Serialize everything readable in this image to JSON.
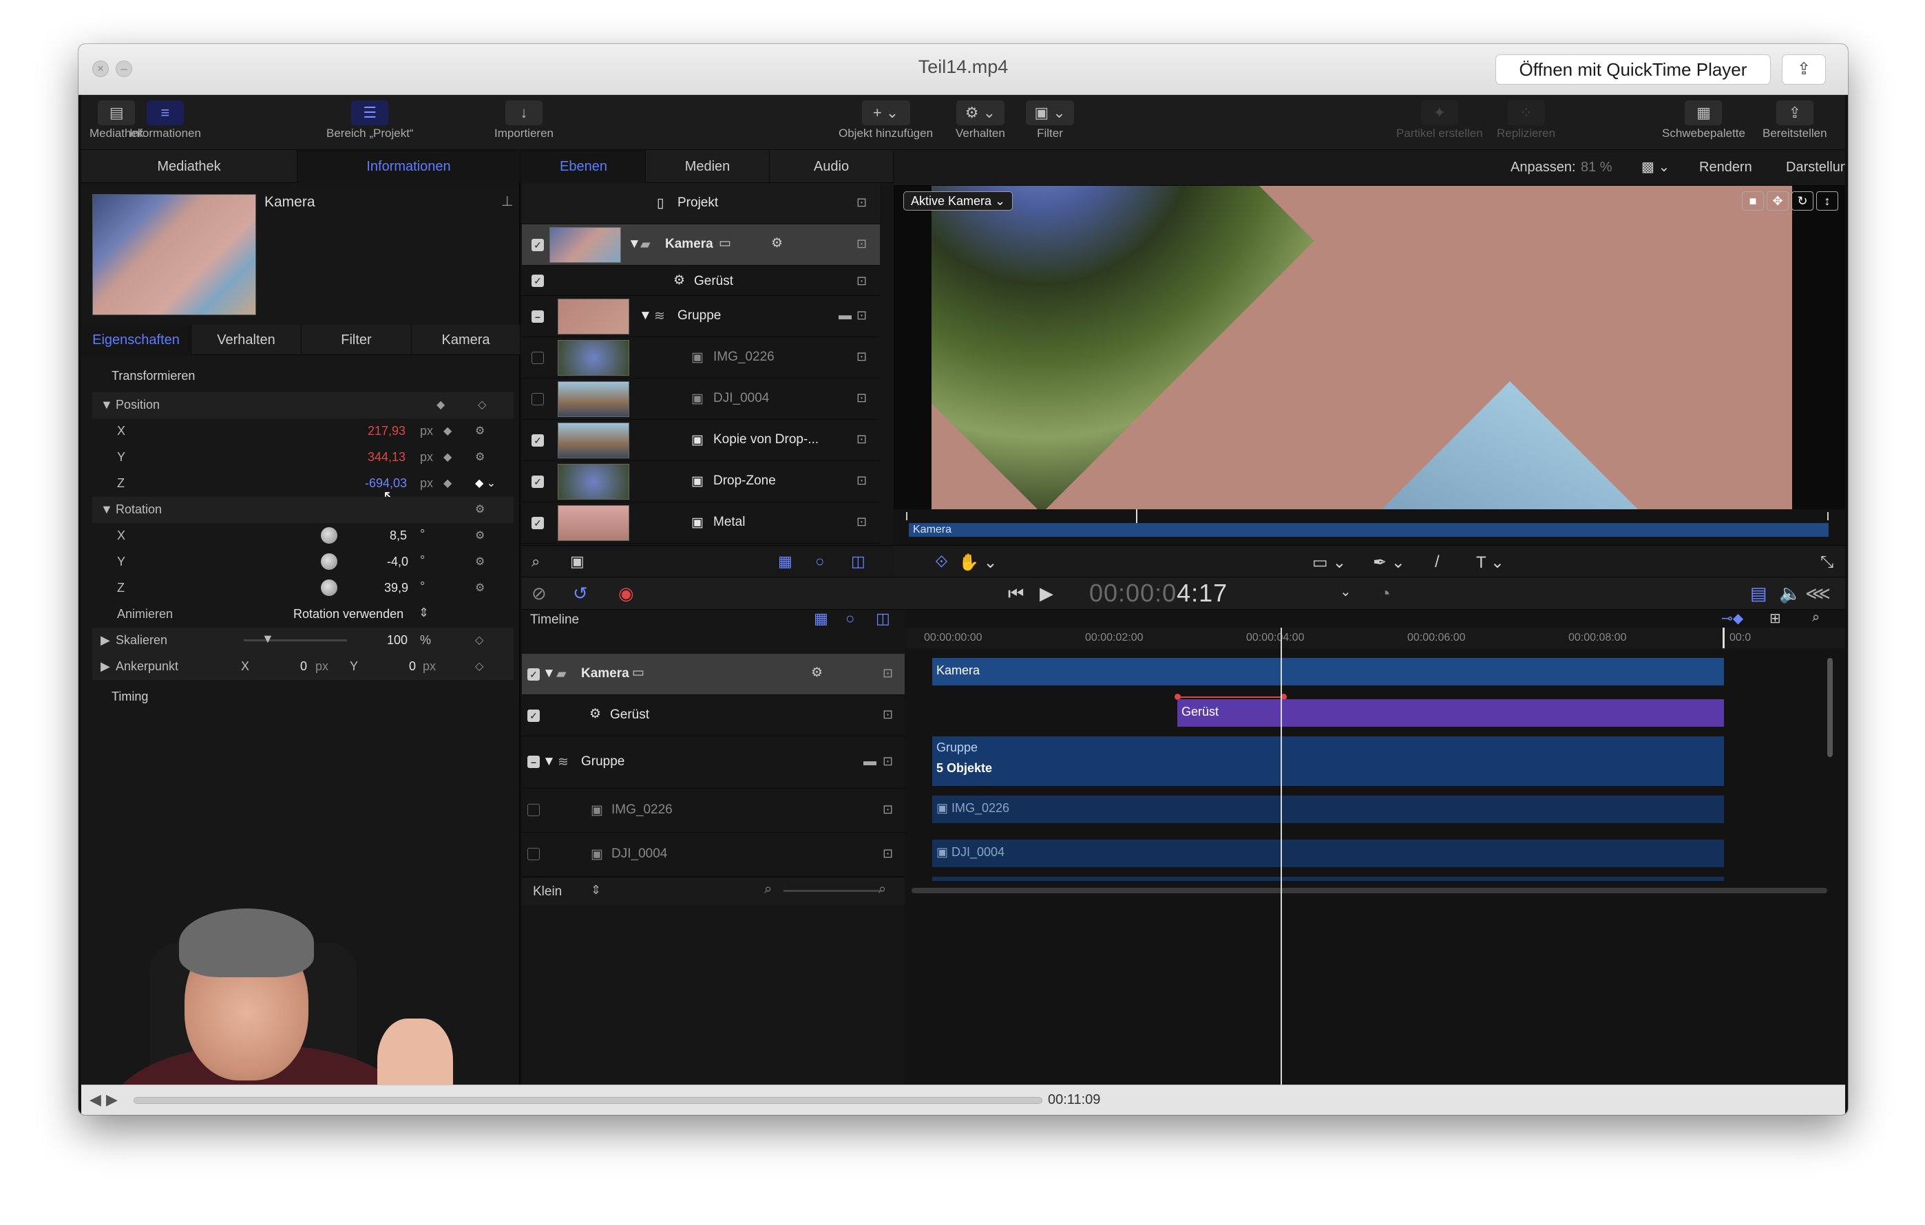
{
  "window": {
    "title": "Teil14.mp4",
    "open_with_label": "Öffnen mit QuickTime Player"
  },
  "toolbar": {
    "library": "Mediathek",
    "inspector": "Informationen",
    "project_pane": "Bereich „Projekt“",
    "import": "Importieren",
    "add_object": "Objekt hinzufügen",
    "behaviors": "Verhalten",
    "filters": "Filter",
    "make_particles": "Partikel erstellen",
    "replicate": "Replizieren",
    "hud": "Schwebepalette",
    "share": "Bereitstellen"
  },
  "left_panel": {
    "tabs": [
      "Mediathek",
      "Informationen"
    ],
    "object_name": "Kamera",
    "subtabs": [
      "Eigenschaften",
      "Verhalten",
      "Filter",
      "Kamera"
    ],
    "transform_label": "Transformieren",
    "position_label": "Position",
    "pos_x_label": "X",
    "pos_x": "217,93",
    "pos_y_label": "Y",
    "pos_y": "344,13",
    "pos_z_label": "Z",
    "pos_z": "-694,03",
    "unit_px": "px",
    "rotation_label": "Rotation",
    "rot_x_label": "X",
    "rot_x": "8,5",
    "rot_y_label": "Y",
    "rot_y": "-4,0",
    "rot_z_label": "Z",
    "rot_z": "39,9",
    "deg": "°",
    "animate_label": "Animieren",
    "animate_value": "Rotation verwenden",
    "scale_label": "Skalieren",
    "scale_value": "100",
    "pct": "%",
    "anchor_label": "Ankerpunkt",
    "anchor_x_label": "X",
    "anchor_x": "0",
    "anchor_y_label": "Y",
    "anchor_y": "0",
    "timing_label": "Timing"
  },
  "layers_panel": {
    "tabs": [
      "Ebenen",
      "Medien",
      "Audio"
    ],
    "project_label": "Projekt",
    "rows": [
      "Kamera",
      "Gerüst",
      "Gruppe",
      "IMG_0226",
      "DJI_0004",
      "Kopie von Drop-...",
      "Drop-Zone",
      "Metal"
    ]
  },
  "viewer": {
    "fit_label": "Anpassen:",
    "fit_value": "81 %",
    "render_label": "Rendern",
    "view_label": "Darstellung",
    "camera_menu": "Aktive Kamera",
    "scrub_label": "Kamera"
  },
  "transport": {
    "timecode_dim": "00:00:0",
    "timecode": "4:17"
  },
  "timeline": {
    "label": "Timeline",
    "ruler": [
      "00:00:00:00",
      "00:00:02:00",
      "00:00:04:00",
      "00:00:06:00",
      "00:00:08:00",
      "00:0"
    ],
    "rows": [
      "Kamera",
      "Gerüst",
      "Gruppe",
      "IMG_0226",
      "DJI_0004"
    ],
    "clips": {
      "kamera": "Kamera",
      "geruest": "Gerüst",
      "gruppe": "Gruppe",
      "objects": "5 Objekte",
      "img": "IMG_0226",
      "dji": "DJI_0004"
    },
    "size_label": "Klein"
  },
  "player": {
    "time_remaining": "00:11:09"
  },
  "colors": {
    "accent": "#5d7cff",
    "keyed_red": "#e04646",
    "clip_blue": "#1e4a86",
    "clip_purple": "#5a3aa8"
  }
}
